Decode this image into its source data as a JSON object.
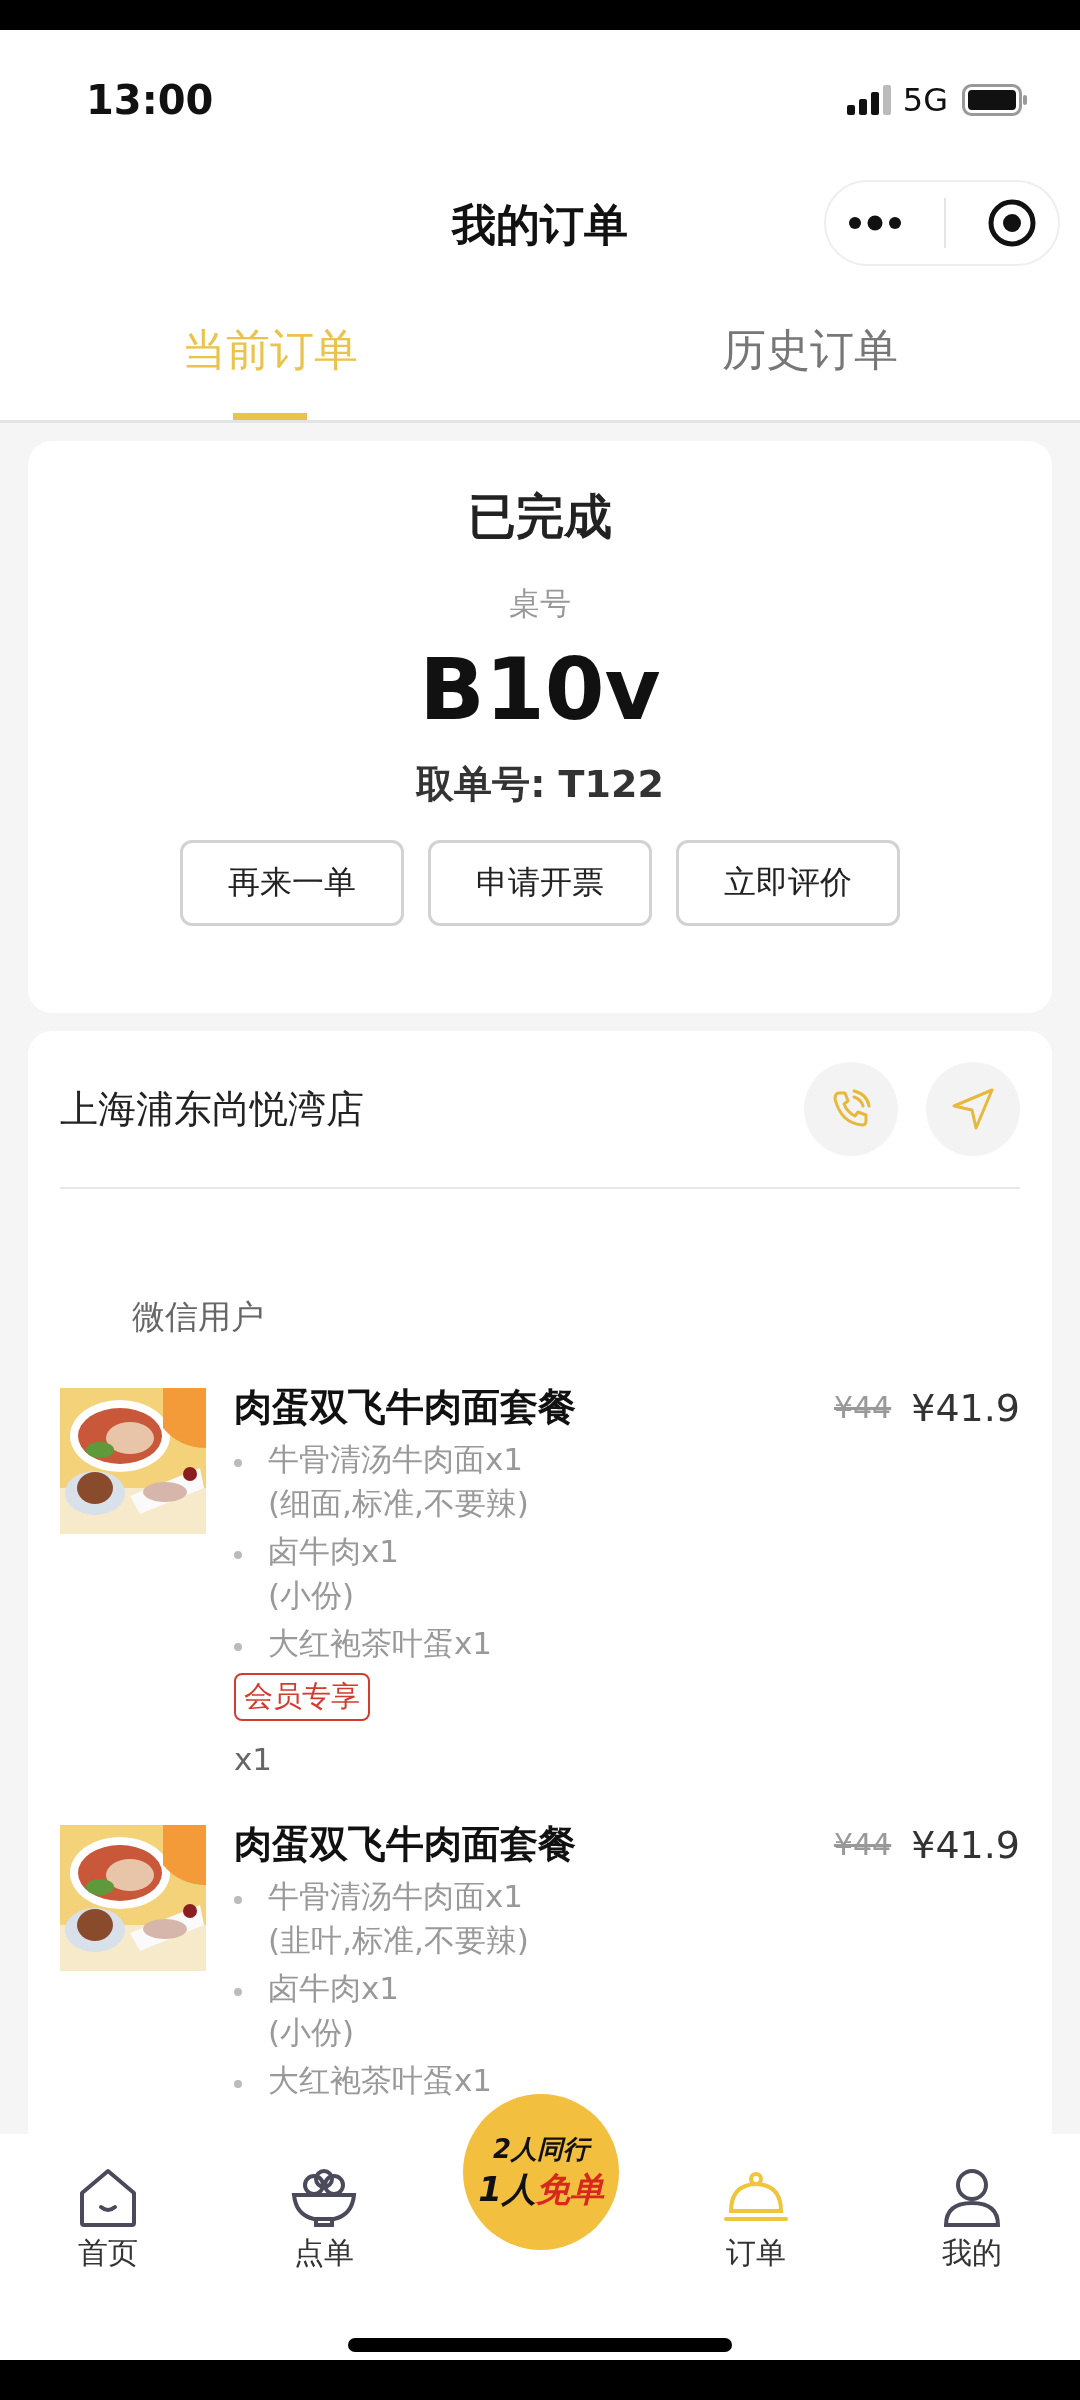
{
  "status_bar": {
    "time": "13:00",
    "network": "5G"
  },
  "header": {
    "title": "我的订单"
  },
  "tabs": [
    {
      "label": "当前订单",
      "selected": true
    },
    {
      "label": "历史订单",
      "selected": false
    }
  ],
  "order": {
    "status": "已完成",
    "table_label": "桌号",
    "table_number": "B10v",
    "pickup": "取单号: T122",
    "actions": [
      "再来一单",
      "申请开票",
      "立即评价"
    ]
  },
  "store": {
    "name": "上海浦东尚悦湾店",
    "customer": "微信用户",
    "items": [
      {
        "image": {
          "kind": "picture"
        },
        "name": "肉蛋双飞牛肉面套餐",
        "original_price": "¥44",
        "price": "¥41.9",
        "components": [
          {
            "name": "牛骨清汤牛肉面x1",
            "options": "(细面,标准,不要辣)"
          },
          {
            "name": "卤牛肉x1",
            "options": "(小份)"
          },
          {
            "name": "大红袍茶叶蛋x1"
          }
        ],
        "tag": "会员专享",
        "quantity": "x1"
      },
      {
        "image": {
          "kind": "picture"
        },
        "name": "肉蛋双飞牛肉面套餐",
        "original_price": "¥44",
        "price": "¥41.9",
        "components": [
          {
            "name": "牛骨清汤牛肉面x1",
            "options": "(韭叶,标准,不要辣)"
          },
          {
            "name": "卤牛肉x1",
            "options": "(小份)"
          },
          {
            "name": "大红袍茶叶蛋x1"
          }
        ]
      }
    ]
  },
  "bottom_nav": {
    "items": [
      {
        "label": "首页",
        "selected": false
      },
      {
        "label": "点单",
        "selected": false
      },
      {
        "label": "订单",
        "selected": true
      },
      {
        "label": "我的",
        "selected": false
      }
    ],
    "promo": {
      "top": "2人同行",
      "bottom": "1人",
      "bottom_highlight": "免单"
    }
  }
}
